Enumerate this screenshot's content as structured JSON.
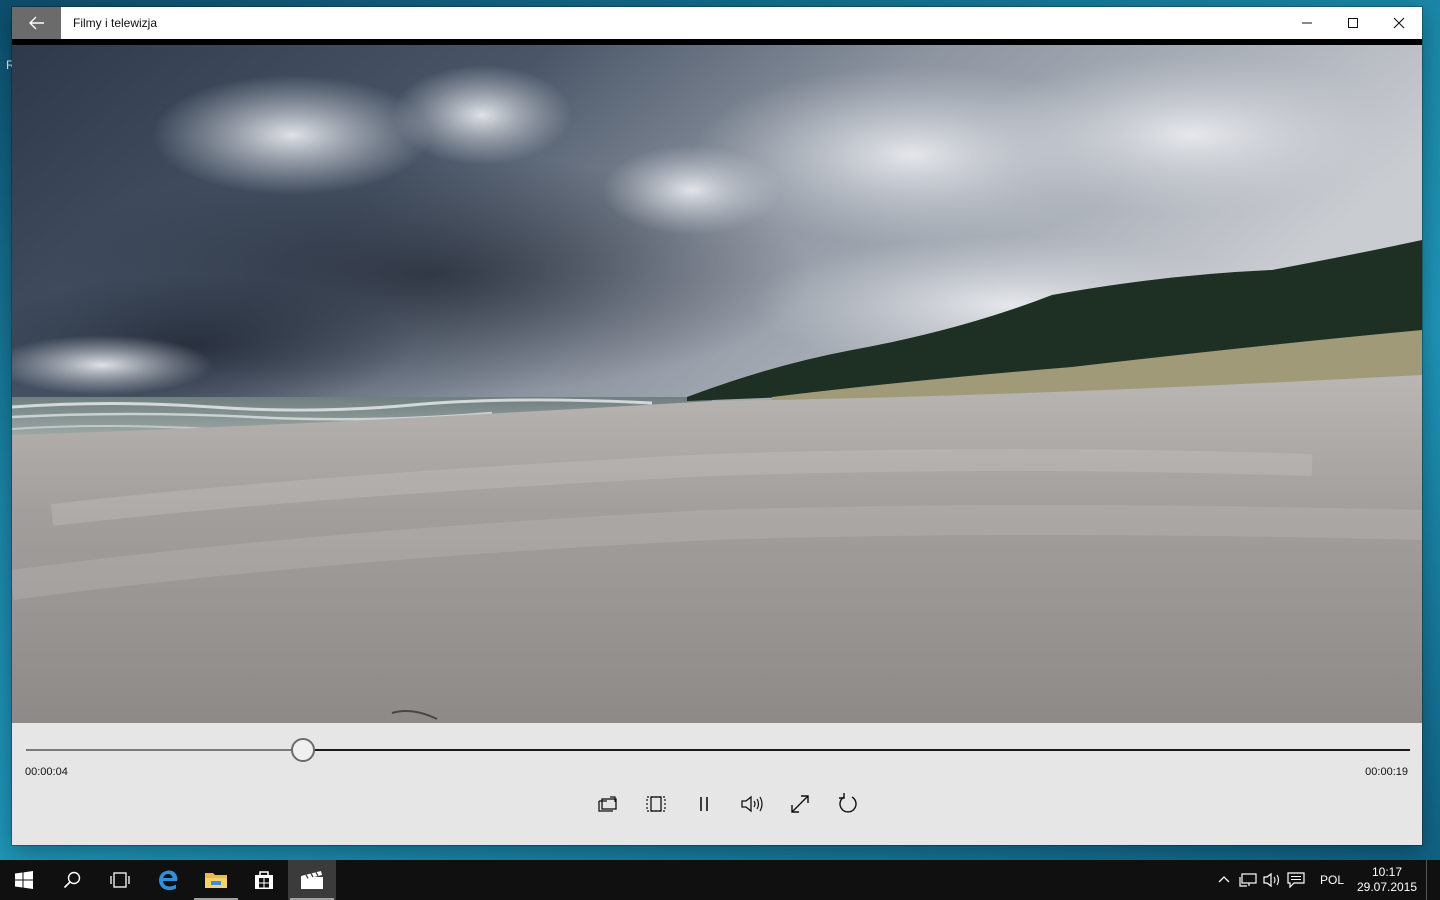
{
  "desktop": {
    "fragment_text": "R"
  },
  "window": {
    "title": "Filmy i telewizja",
    "icons": {
      "back": "back-arrow-icon",
      "minimize": "minimize-icon",
      "maximize": "maximize-icon",
      "close": "close-icon"
    }
  },
  "player": {
    "current_time": "00:00:04",
    "total_time": "00:00:19",
    "progress": 0.2,
    "controls": [
      {
        "name": "cast-to-device-icon"
      },
      {
        "name": "aspect-ratio-icon"
      },
      {
        "name": "pause-icon"
      },
      {
        "name": "volume-icon"
      },
      {
        "name": "fullscreen-icon"
      },
      {
        "name": "repeat-icon"
      }
    ]
  },
  "taskbar": {
    "apps": [
      "start-icon",
      "search-icon",
      "task-view-icon",
      "edge-icon",
      "file-explorer-icon",
      "store-icon",
      "movies-tv-icon"
    ],
    "tray": {
      "icons": [
        "chevron-up-icon",
        "network-icon",
        "speaker-icon",
        "action-center-icon"
      ],
      "language": "POL",
      "time": "10:17",
      "date": "29.07.2015"
    }
  },
  "colors": {
    "taskbar": "#101010",
    "controls_bg": "#e6e6e6",
    "back_button": "#6b6b6b"
  }
}
